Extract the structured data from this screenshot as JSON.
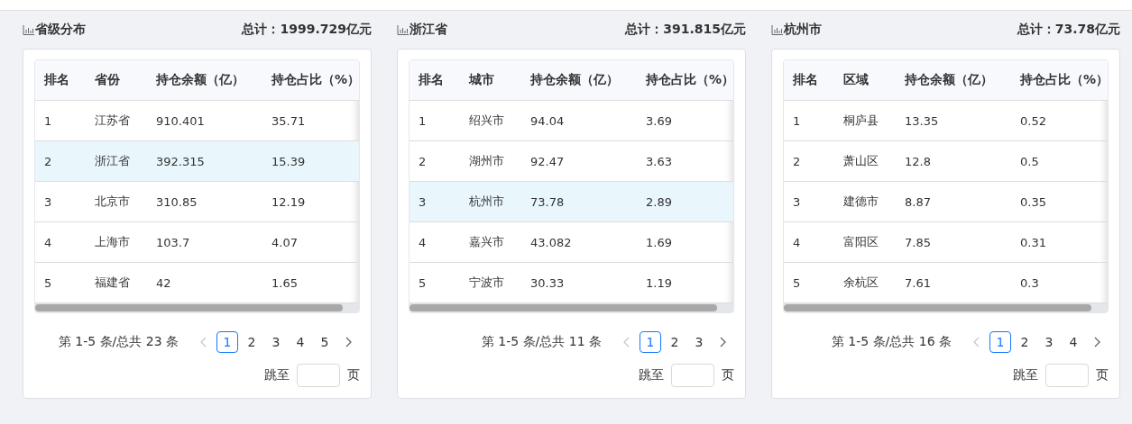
{
  "panels": [
    {
      "title": "省级分布",
      "total": "总计：1999.729亿元",
      "columns": [
        "排名",
        "省份",
        "持仓余额（亿）",
        "持仓占比（%）"
      ],
      "rows": [
        {
          "cells": [
            "1",
            "江苏省",
            "910.401",
            "35.71"
          ],
          "selected": false
        },
        {
          "cells": [
            "2",
            "浙江省",
            "392.315",
            "15.39"
          ],
          "selected": true
        },
        {
          "cells": [
            "3",
            "北京市",
            "310.85",
            "12.19"
          ],
          "selected": false
        },
        {
          "cells": [
            "4",
            "上海市",
            "103.7",
            "4.07"
          ],
          "selected": false
        },
        {
          "cells": [
            "5",
            "福建省",
            "42",
            "1.65"
          ],
          "selected": false
        }
      ],
      "pagination": {
        "summary": "第 1-5 条/总共 23 条",
        "prev_disabled": true,
        "next_disabled": false,
        "pages": [
          {
            "label": "1",
            "selected": true
          },
          {
            "label": "2",
            "selected": false
          },
          {
            "label": "3",
            "selected": false
          },
          {
            "label": "4",
            "selected": false
          },
          {
            "label": "5",
            "selected": false
          }
        ],
        "jump_label": "跳至",
        "jump_suffix": "页"
      }
    },
    {
      "title": "浙江省",
      "total": "总计：391.815亿元",
      "columns": [
        "排名",
        "城市",
        "持仓余额（亿）",
        "持仓占比（%）"
      ],
      "rows": [
        {
          "cells": [
            "1",
            "绍兴市",
            "94.04",
            "3.69"
          ],
          "selected": false
        },
        {
          "cells": [
            "2",
            "湖州市",
            "92.47",
            "3.63"
          ],
          "selected": false
        },
        {
          "cells": [
            "3",
            "杭州市",
            "73.78",
            "2.89"
          ],
          "selected": true
        },
        {
          "cells": [
            "4",
            "嘉兴市",
            "43.082",
            "1.69"
          ],
          "selected": false
        },
        {
          "cells": [
            "5",
            "宁波市",
            "30.33",
            "1.19"
          ],
          "selected": false
        }
      ],
      "pagination": {
        "summary": "第 1-5 条/总共 11 条",
        "prev_disabled": true,
        "next_disabled": false,
        "pages": [
          {
            "label": "1",
            "selected": true
          },
          {
            "label": "2",
            "selected": false
          },
          {
            "label": "3",
            "selected": false
          }
        ],
        "jump_label": "跳至",
        "jump_suffix": "页"
      }
    },
    {
      "title": "杭州市",
      "total": "总计：73.78亿元",
      "columns": [
        "排名",
        "区域",
        "持仓余额（亿）",
        "持仓占比（%）"
      ],
      "rows": [
        {
          "cells": [
            "1",
            "桐庐县",
            "13.35",
            "0.52"
          ],
          "selected": false
        },
        {
          "cells": [
            "2",
            "萧山区",
            "12.8",
            "0.5"
          ],
          "selected": false
        },
        {
          "cells": [
            "3",
            "建德市",
            "8.87",
            "0.35"
          ],
          "selected": false
        },
        {
          "cells": [
            "4",
            "富阳区",
            "7.85",
            "0.31"
          ],
          "selected": false
        },
        {
          "cells": [
            "5",
            "余杭区",
            "7.61",
            "0.3"
          ],
          "selected": false
        }
      ],
      "pagination": {
        "summary": "第 1-5 条/总共 16 条",
        "prev_disabled": true,
        "next_disabled": false,
        "pages": [
          {
            "label": "1",
            "selected": true
          },
          {
            "label": "2",
            "selected": false
          },
          {
            "label": "3",
            "selected": false
          },
          {
            "label": "4",
            "selected": false
          }
        ],
        "jump_label": "跳至",
        "jump_suffix": "页"
      }
    }
  ]
}
